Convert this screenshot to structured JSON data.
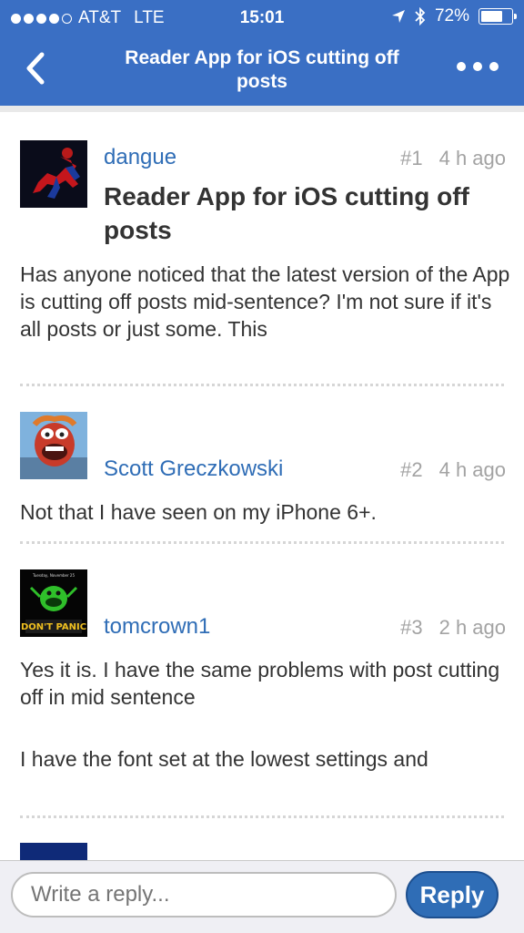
{
  "status_bar": {
    "carrier": "AT&T",
    "network": "LTE",
    "time": "15:01",
    "battery": "72%",
    "battery_level": 0.72
  },
  "header": {
    "title": "Reader App for iOS cutting off posts",
    "color": "#3a6fc4"
  },
  "posts": [
    {
      "username": "dangue",
      "number": "#1",
      "time": "4 h ago",
      "title": "Reader App for iOS cutting off posts",
      "body": "Has anyone noticed that the latest version of the App is cutting off posts mid-sentence? I'm not sure if it's all posts or just some.  This",
      "avatar": "spiderman-avatar"
    },
    {
      "username": "Scott Greczkowski",
      "number": "#2",
      "time": "4 h ago",
      "body": "Not that I have seen on my iPhone 6+.",
      "avatar": "muppet-animal-avatar"
    },
    {
      "username": "tomcrown1",
      "number": "#3",
      "time": "2 h ago",
      "body": "Yes it is. I have the same problems with post cutting off in mid sentence",
      "body2": "I have the font set at the lowest settings and",
      "avatar": "dont-panic-avatar",
      "avatar_caption": "DON'T PANIC",
      "avatar_top_text": "Tuesday, November 25"
    }
  ],
  "reply_bar": {
    "placeholder": "Write a reply...",
    "button_label": "Reply"
  }
}
